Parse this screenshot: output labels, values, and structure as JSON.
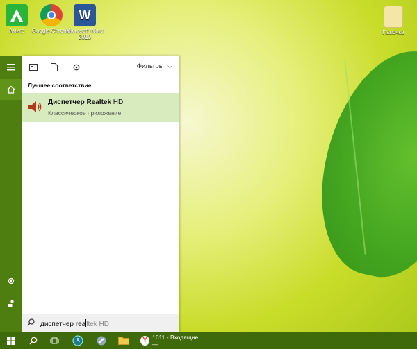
{
  "desktop": {
    "icons": [
      {
        "label": "Амиго",
        "icon": "amigo-icon"
      },
      {
        "label": "Google Chrome",
        "icon": "chrome-icon"
      },
      {
        "label": "Microsoft Word 2010",
        "icon": "word-icon"
      },
      {
        "label": "Папочка",
        "icon": "folder-icon"
      }
    ]
  },
  "search_panel": {
    "filters_label": "Фильтры",
    "section_title": "Лучшее соответствие",
    "best_match": {
      "name_bold": "Диспетчер Realtek",
      "name_rest": " HD",
      "subtitle": "Классическое приложение"
    },
    "query_typed": "диспетчер rea",
    "query_suggestion": "ltek HD"
  },
  "taskbar": {
    "yandex_label": "1611 - Входящие —..."
  },
  "colors": {
    "rail": "#4e7d10",
    "taskbar": "#3e6a0b",
    "result_highlight": "#d8ebbe"
  }
}
